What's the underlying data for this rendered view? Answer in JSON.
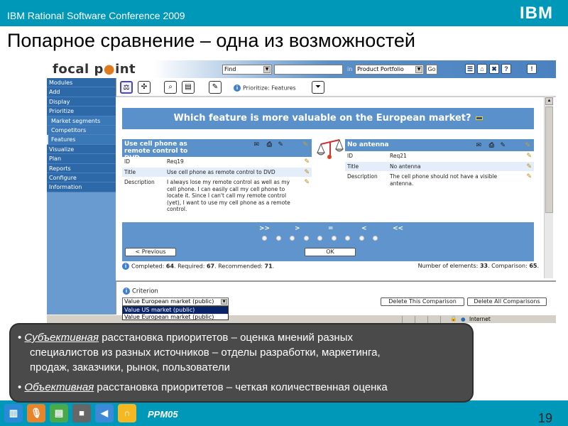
{
  "slide": {
    "conference": "IBM Rational Software Conference 2009",
    "logo": "IBM",
    "title": "Попарное сравнение – одна из возможностей",
    "footer_code": "PPM05",
    "page_number": "19",
    "footer_icons": [
      "equalizer-icon",
      "microphone-icon",
      "clapperboard-icon",
      "camera-icon",
      "speaker-icon",
      "headphones-icon"
    ]
  },
  "app": {
    "logo_prefix": "focal p",
    "logo_dot": "●",
    "logo_suffix": "int",
    "search": {
      "find_select": "Find",
      "find_input": "",
      "in_label": "in",
      "scope_select": "Product Portfolio",
      "go_label": "Go"
    },
    "header_icons": [
      "list-icon",
      "home-icon",
      "tools-icon",
      "help-icon",
      "logout-icon"
    ],
    "header_glyphs": [
      "☰",
      "⌂",
      "✖",
      "?",
      "!"
    ],
    "nav": [
      {
        "label": "Modules",
        "sub": false
      },
      {
        "label": "Add",
        "sub": false
      },
      {
        "label": "Display",
        "sub": false
      },
      {
        "label": "Prioritize",
        "sub": false
      },
      {
        "label": "Market segments",
        "sub": true
      },
      {
        "label": "Competitors",
        "sub": true
      },
      {
        "label": "Features",
        "sub": true,
        "active": true
      },
      {
        "label": "Visualize",
        "sub": false
      },
      {
        "label": "Plan",
        "sub": false
      },
      {
        "label": "Reports",
        "sub": false
      },
      {
        "label": "Configure",
        "sub": false
      },
      {
        "label": "Information",
        "sub": false
      }
    ],
    "toolbar": {
      "info_text": "Prioritize: Features",
      "glyphs": {
        "compare": "⚖",
        "network": "✣",
        "find": "⌕",
        "table": "▤",
        "edit": "✎",
        "filter": "⏷"
      }
    },
    "question": "Which feature is more valuable on the European market?",
    "left_feature": {
      "header": "Use cell phone as remote control to DVD",
      "rows": [
        {
          "key": "ID",
          "value": "Req19"
        },
        {
          "key": "Title",
          "value": "Use cell phone as remote control to DVD"
        },
        {
          "key": "Description",
          "value": "I always lose my remote control as well as my cell phone. I can easily call my cell phone to locate it. Since I can't call my remote control (yet), I want to use my cell phone as a remote control."
        }
      ]
    },
    "right_feature": {
      "header": "No antenna",
      "rows": [
        {
          "key": "ID",
          "value": "Req21"
        },
        {
          "key": "Title",
          "value": "No antenna"
        },
        {
          "key": "Description",
          "value": "The cell phone should not have a visible antenna."
        }
      ]
    },
    "comparison": {
      "labels": [
        ">>",
        ">",
        "=",
        "<",
        "<<"
      ],
      "radio_count": 9,
      "selected": null,
      "prev_label": "< Previous",
      "ok_label": "OK"
    },
    "stats": {
      "completed_label": "Completed:",
      "completed": "64",
      "required_label": "Required:",
      "required": "67",
      "recommended_label": "Recommended:",
      "recommended": "71",
      "elements_label": "Number of elements:",
      "elements": "33",
      "comparison_label": "Comparison:",
      "comparison": "65"
    },
    "criterion": {
      "label": "Criterion",
      "selected": "Value European market (public)",
      "options": [
        "Value US market (public)",
        "Value European market (public)"
      ],
      "highlighted": "Value US market (public)",
      "delete_this": "Delete This Comparison",
      "delete_all": "Delete All Comparisons"
    },
    "statusbar": {
      "zone": "Internet"
    }
  },
  "notes": [
    {
      "emph": "Субъективная",
      "line1": " расстановка приоритетов – оценка мнений разных",
      "line2": "специалистов из разных источников – отделы разработки, маркетинга,",
      "line3": "продаж, заказчики, рынок, пользователи"
    },
    {
      "emph": "Объективная",
      "line1": " расстановка приоритетов – четкая количественная оценка"
    }
  ]
}
